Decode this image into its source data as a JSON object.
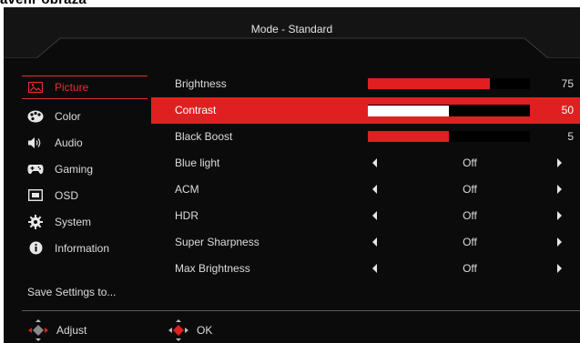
{
  "cropped_title": "avenr obraza",
  "header": {
    "title": "Mode - Standard"
  },
  "sidebar": {
    "items": [
      {
        "label": "Picture",
        "icon": "picture-icon",
        "active": true
      },
      {
        "label": "Color",
        "icon": "palette-icon"
      },
      {
        "label": "Audio",
        "icon": "speaker-icon"
      },
      {
        "label": "Gaming",
        "icon": "gamepad-icon"
      },
      {
        "label": "OSD",
        "icon": "osd-icon"
      },
      {
        "label": "System",
        "icon": "gear-icon"
      },
      {
        "label": "Information",
        "icon": "info-icon"
      }
    ],
    "save_label": "Save Settings to..."
  },
  "settings": [
    {
      "label": "Brightness",
      "type": "slider",
      "value": "75",
      "fill": 0.75
    },
    {
      "label": "Contrast",
      "type": "slider",
      "value": "50",
      "fill": 0.5,
      "selected": true
    },
    {
      "label": "Black Boost",
      "type": "slider",
      "value": "5",
      "fill": 0.5
    },
    {
      "label": "Blue light",
      "type": "option",
      "value": "Off"
    },
    {
      "label": "ACM",
      "type": "option",
      "value": "Off"
    },
    {
      "label": "HDR",
      "type": "option",
      "value": "Off"
    },
    {
      "label": "Super Sharpness",
      "type": "option",
      "value": "Off"
    },
    {
      "label": "Max  Brightness",
      "type": "option",
      "value": "Off"
    }
  ],
  "footer": {
    "adjust_label": "Adjust",
    "ok_label": "OK"
  },
  "colors": {
    "accent": "#e02020",
    "background": "#0b0b0b",
    "text": "#dcdcdc"
  }
}
